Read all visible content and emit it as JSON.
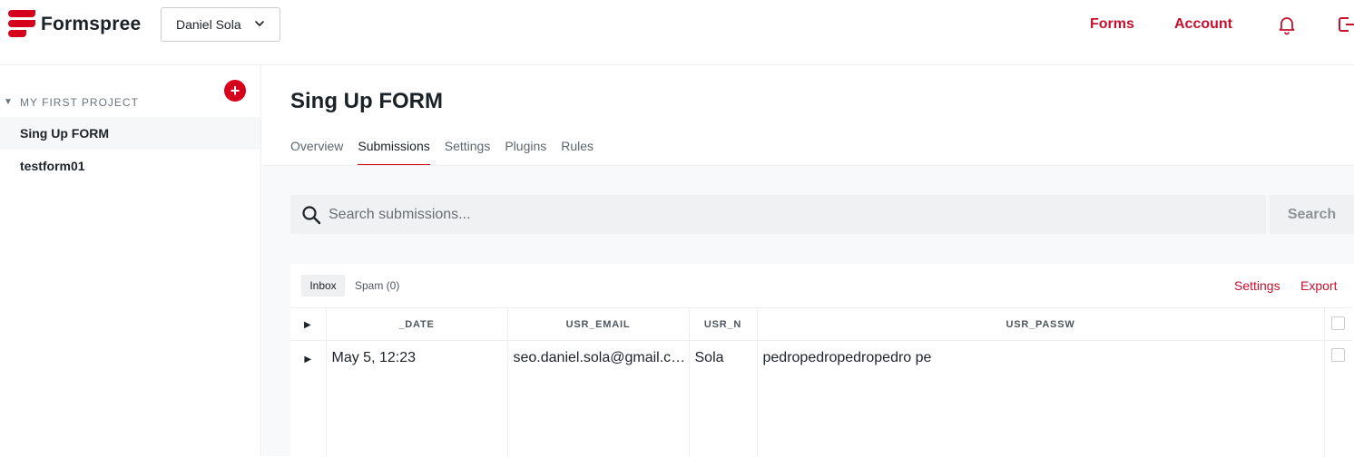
{
  "header": {
    "brand": "Formspree",
    "account_selector": "Daniel Sola",
    "nav": {
      "forms": "Forms",
      "account": "Account"
    },
    "icons": {
      "notifications": "bell-icon",
      "logout": "logout-icon"
    },
    "accent_color": "#d5001c"
  },
  "sidebar": {
    "project_name": "MY FIRST PROJECT",
    "add_icon": "plus-icon",
    "items": [
      {
        "label": "Sing Up FORM",
        "active": true
      },
      {
        "label": "testform01",
        "active": false
      }
    ]
  },
  "main": {
    "title": "Sing Up FORM",
    "tabs": [
      {
        "label": "Overview"
      },
      {
        "label": "Submissions",
        "active": true
      },
      {
        "label": "Settings"
      },
      {
        "label": "Plugins"
      },
      {
        "label": "Rules"
      }
    ],
    "search": {
      "placeholder": "Search submissions...",
      "button": "Search"
    },
    "submissions": {
      "filters": {
        "inbox": "Inbox",
        "spam": "Spam (0)"
      },
      "actions": {
        "settings": "Settings",
        "export": "Export"
      },
      "columns": [
        "_DATE",
        "USR_EMAIL",
        "USR_N",
        "USR_PASSW"
      ],
      "rows": [
        {
          "date": "May 5, 12:23",
          "email": "seo.daniel.sola@gmail.com",
          "name": "Sola",
          "password": "pedropedropedropedro pe"
        }
      ]
    }
  }
}
